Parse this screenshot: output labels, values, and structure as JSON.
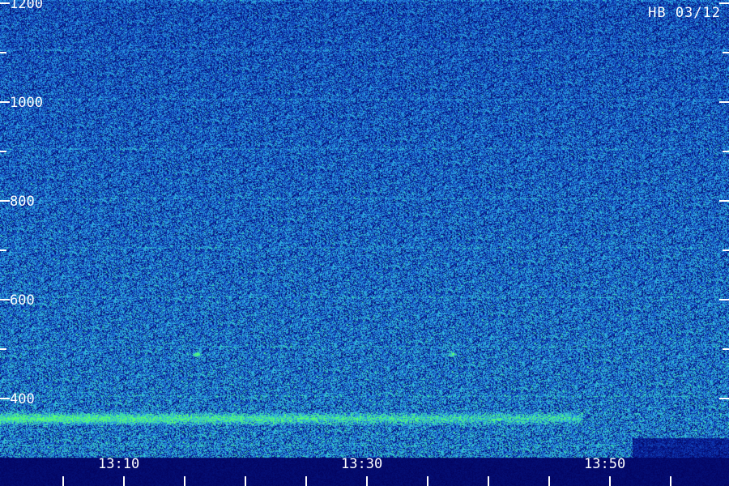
{
  "station_label": "HB 03/12",
  "chart_data": {
    "type": "heatmap",
    "title": "",
    "xlabel": "",
    "ylabel": "",
    "x_range": [
      "13:04",
      "13:54"
    ],
    "y_range": [
      350,
      1200
    ],
    "y_ticks": [
      {
        "value": 1200,
        "label": "1200"
      },
      {
        "value": 1000,
        "label": "1000"
      },
      {
        "value": 800,
        "label": "800"
      },
      {
        "value": 600,
        "label": "600"
      },
      {
        "value": 400,
        "label": "400"
      }
    ],
    "x_ticks": [
      {
        "value": "13:10",
        "label": "13:10"
      },
      {
        "value": "13:30",
        "label": "13:30"
      },
      {
        "value": "13:50",
        "label": "13:50"
      }
    ],
    "colormap": [
      "#03035e",
      "#0a2aa8",
      "#1f78d8",
      "#34b8e8",
      "#38e0a8",
      "#5cff70"
    ],
    "features": [
      {
        "name": "low-frequency band",
        "y": 360,
        "x_start": "13:04",
        "x_end": "13:54",
        "intensity": 0.8
      },
      {
        "name": "burst",
        "y": 490,
        "x": "13:16",
        "intensity": 0.9
      },
      {
        "name": "burst",
        "y": 490,
        "x": "13:37",
        "intensity": 0.7
      }
    ]
  }
}
